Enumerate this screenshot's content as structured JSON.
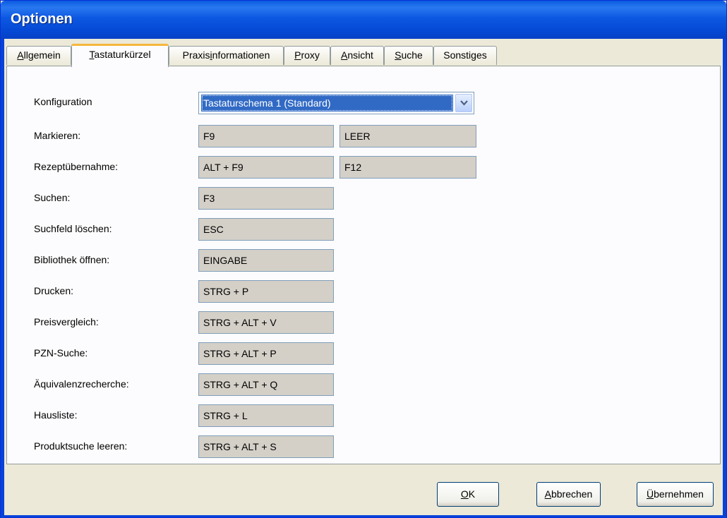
{
  "window": {
    "title": "Optionen"
  },
  "tabs": [
    {
      "pre": "",
      "key": "A",
      "post": "llgemein"
    },
    {
      "pre": "",
      "key": "T",
      "post": "astaturkürzel"
    },
    {
      "pre": "Praxis",
      "key": "i",
      "post": "nformationen"
    },
    {
      "pre": "",
      "key": "P",
      "post": "roxy"
    },
    {
      "pre": "",
      "key": "A",
      "post": "nsicht"
    },
    {
      "pre": "",
      "key": "S",
      "post": "uche"
    },
    {
      "pre": "Sonstiges",
      "key": "",
      "post": ""
    }
  ],
  "active_tab": "Tastaturkürzel",
  "config": {
    "label": "Konfiguration",
    "value": "Tastaturschema 1 (Standard)"
  },
  "shortcuts": [
    {
      "label": "Markieren:",
      "key1": "F9",
      "key2": "LEER"
    },
    {
      "label": "Rezeptübernahme:",
      "key1": "ALT + F9",
      "key2": "F12"
    },
    {
      "label": "Suchen:",
      "key1": "F3"
    },
    {
      "label": "Suchfeld löschen:",
      "key1": "ESC"
    },
    {
      "label": "Bibliothek öffnen:",
      "key1": "EINGABE"
    },
    {
      "label": "Drucken:",
      "key1": "STRG + P"
    },
    {
      "label": "Preisvergleich:",
      "key1": "STRG + ALT + V"
    },
    {
      "label": "PZN-Suche:",
      "key1": "STRG + ALT + P"
    },
    {
      "label": "Äquivalenzrecherche:",
      "key1": "STRG + ALT + Q"
    },
    {
      "label": "Hausliste:",
      "key1": "STRG + L"
    },
    {
      "label": "Produktsuche leeren:",
      "key1": "STRG + ALT + S"
    }
  ],
  "buttons": {
    "ok": {
      "key": "O",
      "rest": "K"
    },
    "cancel": {
      "key": "A",
      "rest": "bbrechen"
    },
    "apply": {
      "key": "Ü",
      "rest": "bernehmen"
    }
  }
}
